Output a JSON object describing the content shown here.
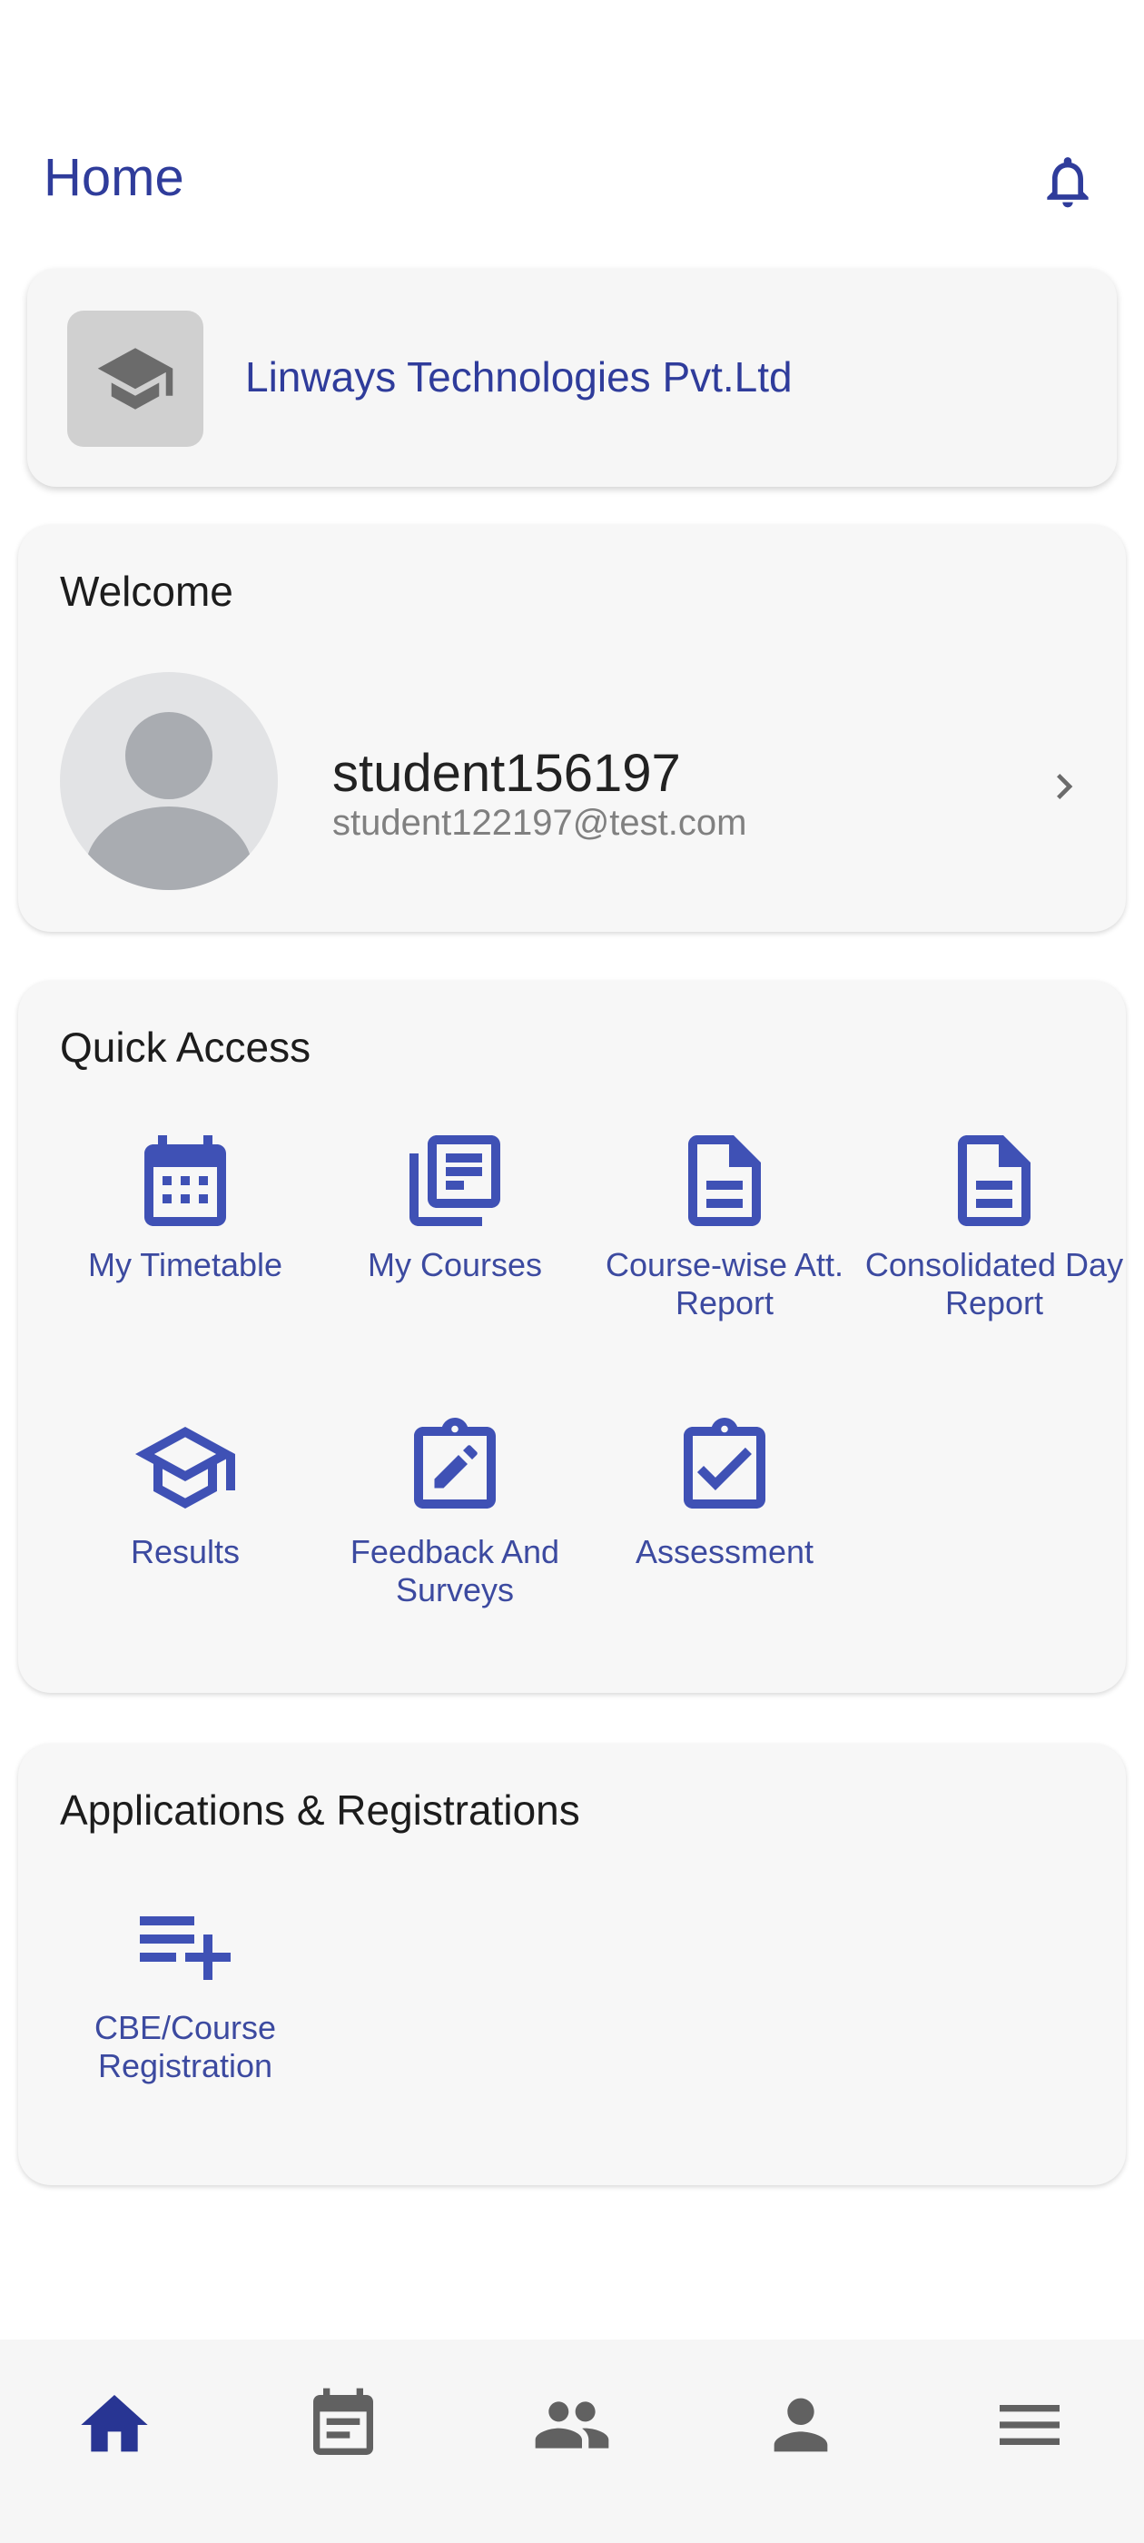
{
  "header": {
    "title": "Home",
    "bell_icon": "bell-icon"
  },
  "institution": {
    "name": "Linways Technologies Pvt.Ltd",
    "logo_icon": "graduation-cap-icon"
  },
  "welcome": {
    "title": "Welcome",
    "username": "student156197",
    "email": "student122197@test.com",
    "avatar_icon": "person-avatar-icon"
  },
  "quick_access": {
    "title": "Quick Access",
    "items": [
      {
        "label": "My Timetable",
        "icon": "calendar-icon"
      },
      {
        "label": "My Courses",
        "icon": "library-books-icon"
      },
      {
        "label": "Course-wise Att. Report",
        "icon": "document-icon"
      },
      {
        "label": "Consolidated Day Report",
        "icon": "document-icon"
      },
      {
        "label": "Results",
        "icon": "school-icon"
      },
      {
        "label": "Feedback And Surveys",
        "icon": "clipboard-edit-icon"
      },
      {
        "label": "Assessment",
        "icon": "clipboard-check-icon"
      }
    ]
  },
  "applications": {
    "title": "Applications & Registrations",
    "items": [
      {
        "label": "CBE/Course Registration",
        "icon": "playlist-add-icon"
      }
    ]
  },
  "bottom_nav": {
    "items": [
      {
        "icon": "home-icon",
        "active": true
      },
      {
        "icon": "event-note-icon",
        "active": false
      },
      {
        "icon": "people-icon",
        "active": false
      },
      {
        "icon": "person-icon",
        "active": false
      },
      {
        "icon": "menu-icon",
        "active": false
      }
    ]
  },
  "colors": {
    "accent": "#3f51b5",
    "title": "#2f3c9b",
    "nav_inactive": "#616161"
  }
}
